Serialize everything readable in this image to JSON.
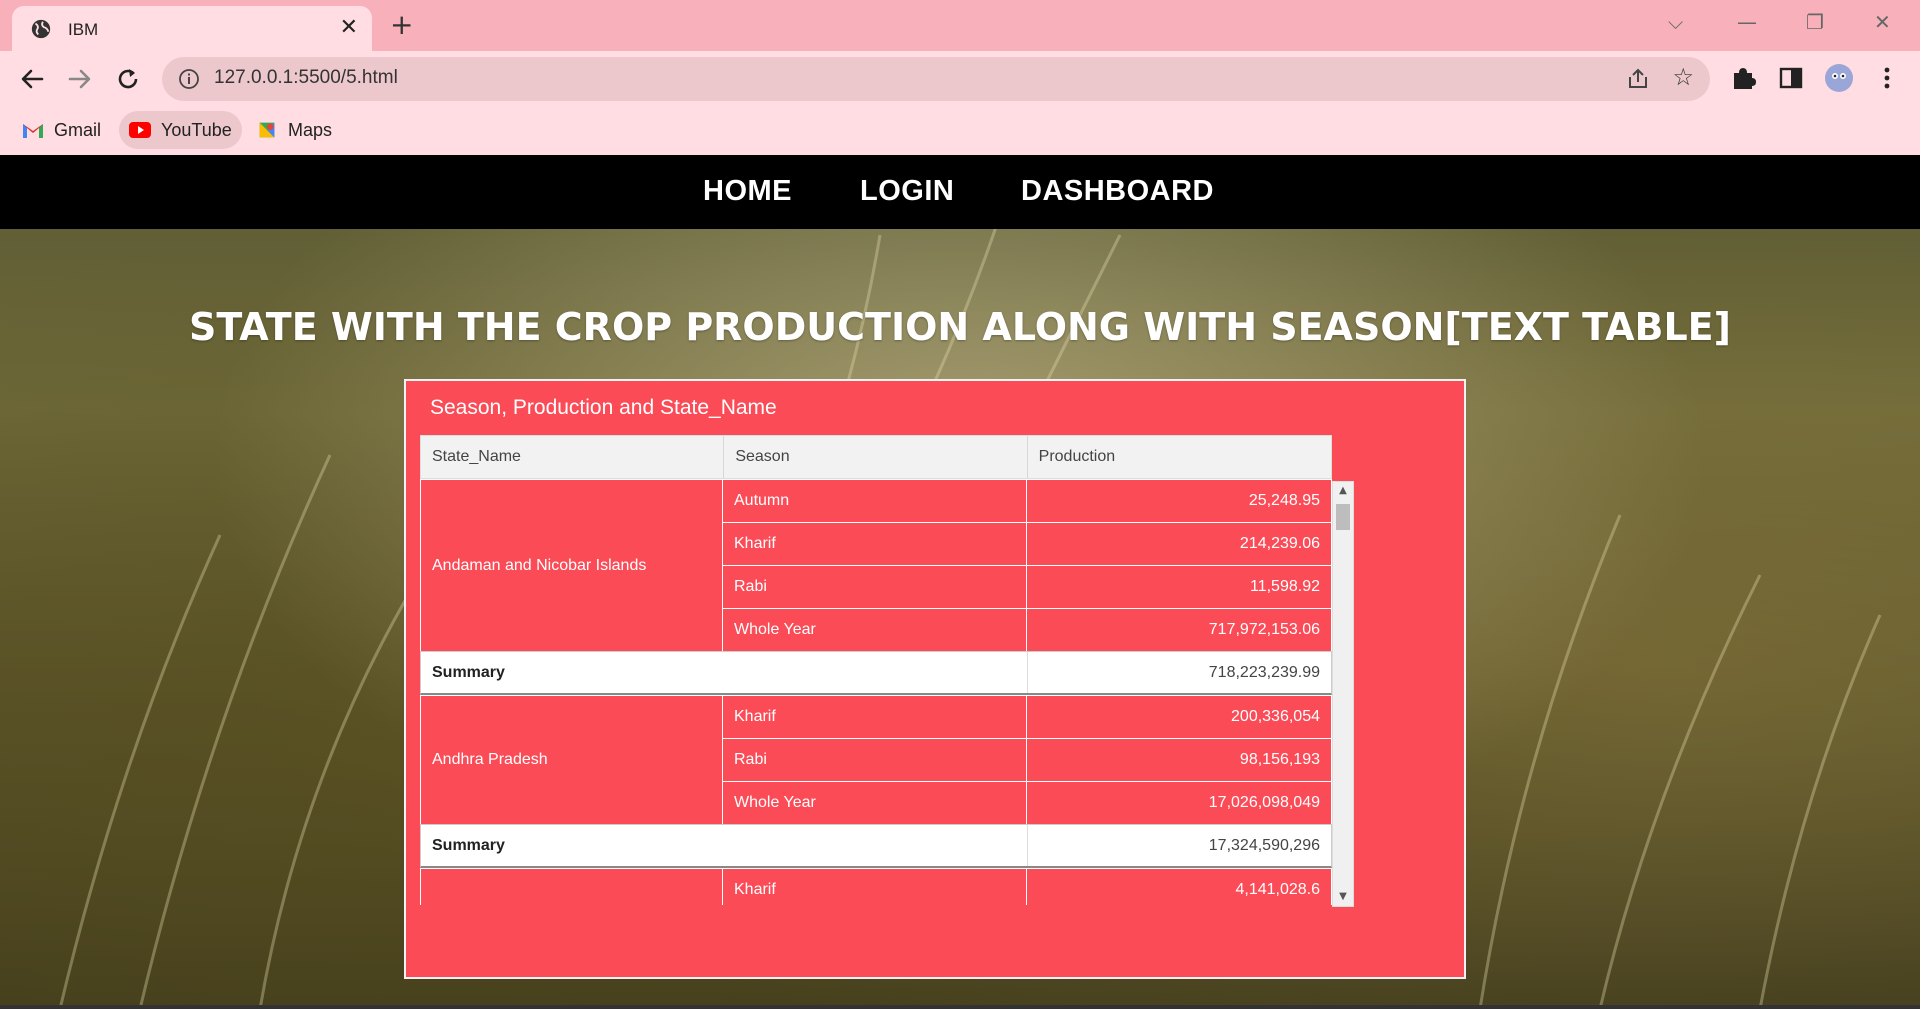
{
  "browser": {
    "tab_title": "IBM",
    "url": "127.0.0.1:5500/5.html",
    "bookmarks": [
      {
        "label": "Gmail",
        "icon": "gmail-icon"
      },
      {
        "label": "YouTube",
        "icon": "youtube-icon"
      },
      {
        "label": "Maps",
        "icon": "maps-icon"
      }
    ]
  },
  "nav": {
    "home": "HOME",
    "login": "LOGIN",
    "dashboard": "DASHBOARD"
  },
  "headline": "STATE WITH THE CROP PRODUCTION ALONG WITH SEASON[TEXT TABLE]",
  "panel": {
    "title": "Season, Production and State_Name",
    "columns": [
      "State_Name",
      "Season",
      "Production"
    ],
    "groups": [
      {
        "state": "Andaman and Nicobar Islands",
        "rows": [
          {
            "season": "Autumn",
            "production": "25,248.95"
          },
          {
            "season": "Kharif",
            "production": "214,239.06"
          },
          {
            "season": "Rabi",
            "production": "11,598.92"
          },
          {
            "season": "Whole Year",
            "production": "717,972,153.06"
          }
        ],
        "summary_label": "Summary",
        "summary_value": "718,223,239.99"
      },
      {
        "state": "Andhra Pradesh",
        "rows": [
          {
            "season": "Kharif",
            "production": "200,336,054"
          },
          {
            "season": "Rabi",
            "production": "98,156,193"
          },
          {
            "season": "Whole Year",
            "production": "17,026,098,049"
          }
        ],
        "summary_label": "Summary",
        "summary_value": "17,324,590,296"
      },
      {
        "state": "",
        "rows": [
          {
            "season": "Kharif",
            "production": "4,141,028.6"
          }
        ]
      }
    ]
  },
  "colors": {
    "panel": "#fb4b57",
    "tabbar": "#f8b1bb",
    "toolbar": "#ffdde2",
    "nav": "#000000"
  }
}
